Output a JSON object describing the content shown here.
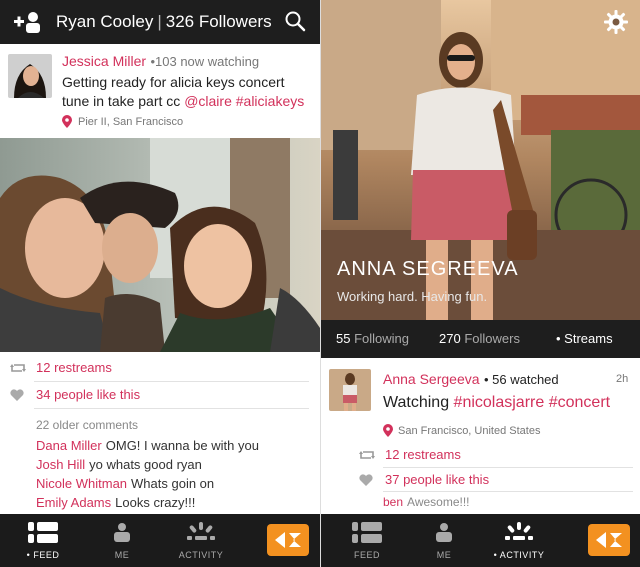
{
  "left": {
    "header": {
      "username": "Ryan Cooley",
      "followers": "326 Followers"
    },
    "post": {
      "author": "Jessica Miller",
      "meta": "•103 now watching",
      "text_line1": "Getting ready for alicia keys concert",
      "text_line2_plain": "tune in take part cc ",
      "mention": "@claire",
      "hashtag": "#aliciakeys",
      "location": "Pier II, San Francisco"
    },
    "restreams": "12 restreams",
    "likes": "34 people like this",
    "older_comments": "22 older comments",
    "comments": [
      {
        "name": "Dana Miller",
        "text": "OMG! I wanna be with you"
      },
      {
        "name": "Josh Hill",
        "text": "yo whats good ryan"
      },
      {
        "name": "Nicole Whitman",
        "text": "Whats goin on"
      },
      {
        "name": "Emily Adams",
        "text": "Looks crazy!!!"
      }
    ],
    "nav": {
      "feed": "• FEED",
      "me": "ME",
      "activity": "ACTIVITY"
    }
  },
  "right": {
    "profile_name": "ANNA SEGREEVA",
    "tagline": "Working hard. Having fun.",
    "following_count": "55",
    "following_label": "Following",
    "followers_count": "270",
    "followers_label": "Followers",
    "streams_label": "• Streams",
    "post": {
      "author": "Anna Sergeeva",
      "meta": "• 56 watched",
      "time": "2h",
      "text_plain": "Watching ",
      "hashtag1": "#nicolasjarre",
      "hashtag2": "#concert",
      "location": "San Francisco, United States"
    },
    "restreams": "12 restreams",
    "likes": "37 people like this",
    "comment": {
      "name": "ben",
      "text": "Awesome!!!"
    },
    "nav": {
      "feed": "FEED",
      "me": "ME",
      "activity": "• ACTIVITY"
    }
  },
  "colors": {
    "accent": "#d2315b",
    "brand_orange": "#f39120",
    "bar_dark": "#1e1e1e"
  }
}
